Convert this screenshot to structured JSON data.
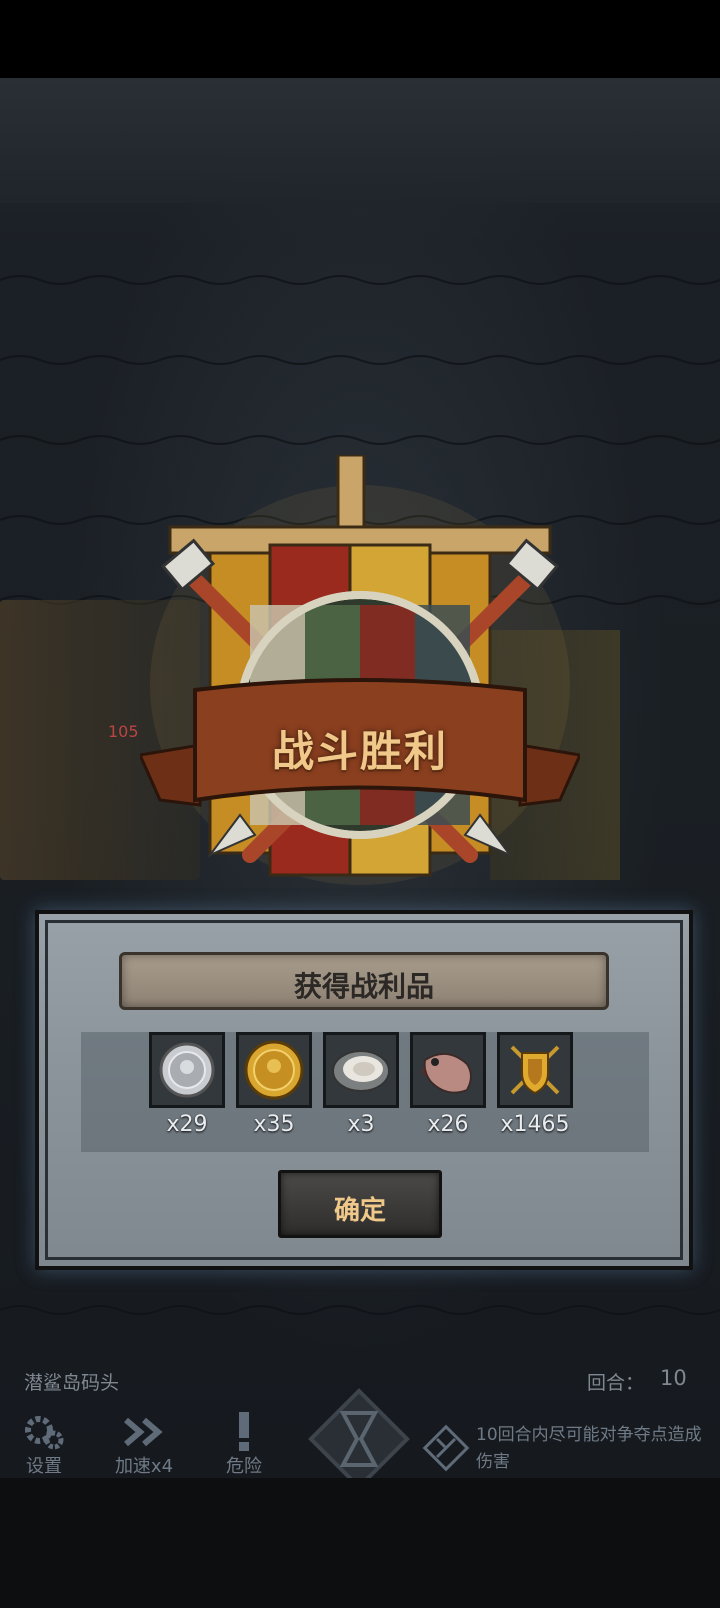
{
  "victory": {
    "title": "战斗胜利"
  },
  "battlefield": {
    "hp_hint": "105"
  },
  "rewards": {
    "title": "获得战利品",
    "items": [
      {
        "icon": "silver-coin-icon",
        "count": "x29"
      },
      {
        "icon": "gold-coin-icon",
        "count": "x35"
      },
      {
        "icon": "oyster-icon",
        "count": "x3"
      },
      {
        "icon": "fish-icon",
        "count": "x26"
      },
      {
        "icon": "honor-shield-icon",
        "count": "x1465"
      }
    ],
    "confirm_label": "确定"
  },
  "hud": {
    "location": "潜鲨岛码头",
    "round_label": "回合：",
    "round_value": "10",
    "buttons": [
      {
        "icon": "gear-icon",
        "label": "设置"
      },
      {
        "icon": "fast-forward-icon",
        "label": "加速x4"
      },
      {
        "icon": "danger-icon",
        "label": "危险"
      }
    ],
    "mission_text": "10回合内尽可能对争夺点造成伤害"
  },
  "colors": {
    "accent_gold": "#f0c98a",
    "panel_gray": "#8c959c",
    "ribbon_brown": "#8a3f1f"
  }
}
